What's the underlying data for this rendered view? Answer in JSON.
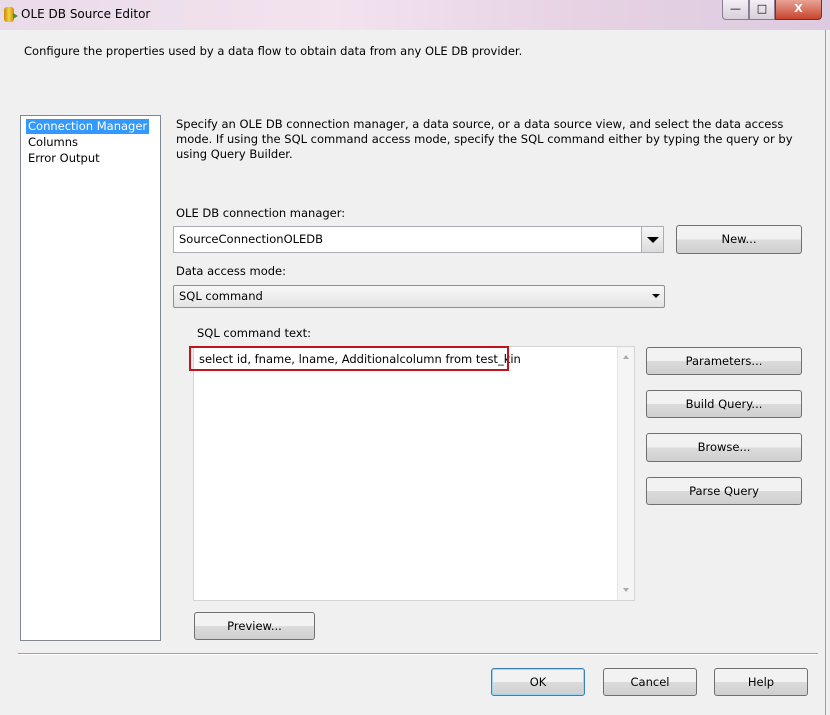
{
  "window": {
    "title": "OLE DB Source Editor",
    "controls": {
      "minimize": "—",
      "maximize": "□",
      "close": "X"
    }
  },
  "description": "Configure the properties used by a data flow to obtain data from any OLE DB provider.",
  "nav": {
    "items": [
      {
        "label": "Connection Manager",
        "selected": true
      },
      {
        "label": "Columns",
        "selected": false
      },
      {
        "label": "Error Output",
        "selected": false
      }
    ]
  },
  "main": {
    "intro": "Specify an OLE DB connection manager, a data source, or a data source view, and select the data access mode. If using the SQL command access mode, specify the SQL command either by typing the query or by using Query Builder.",
    "connection_label": "OLE DB connection manager:",
    "connection_value": "SourceConnectionOLEDB",
    "new_button": "New...",
    "access_mode_label": "Data access mode:",
    "access_mode_value": "SQL command",
    "sql_label": "SQL command text:",
    "sql_text": "select id, fname, lname, Additionalcolumn from test_kin",
    "highlight_color": "#c0141c",
    "buttons": {
      "parameters": "Parameters...",
      "build_query": "Build Query...",
      "browse": "Browse...",
      "parse_query": "Parse Query",
      "preview": "Preview..."
    }
  },
  "footer": {
    "ok": "OK",
    "cancel": "Cancel",
    "help": "Help"
  }
}
